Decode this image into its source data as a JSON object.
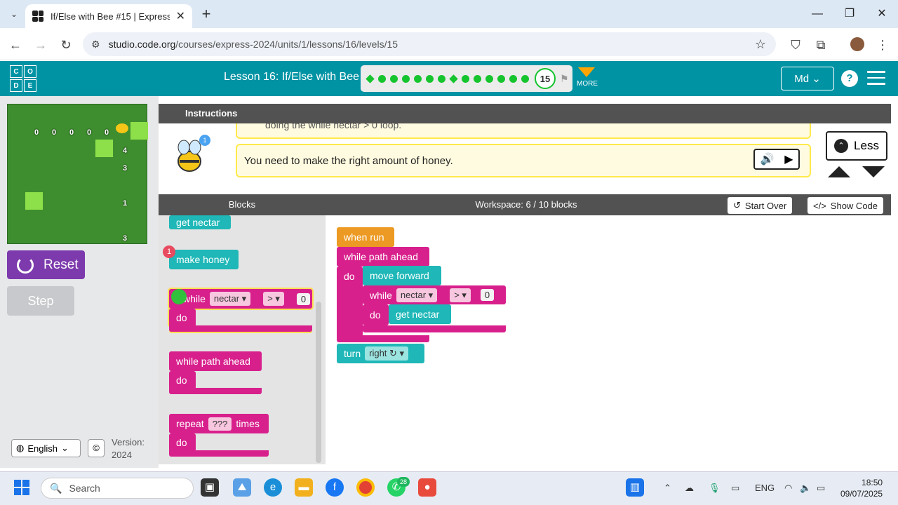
{
  "browser": {
    "tab_title": "If/Else with Bee #15 | Express C",
    "tab_close": "✕",
    "new_tab": "+",
    "url_host": "studio.code.org",
    "url_path": "/courses/express-2024/units/1/lessons/16/levels/15",
    "minimize": "—",
    "restore": "❐",
    "close": "✕"
  },
  "header": {
    "logo_letters": [
      "C",
      "O",
      "D",
      "E"
    ],
    "lesson_title": "Lesson 16: If/Else with Bee",
    "level_number": "15",
    "progress_completed": 14,
    "more_label": "MORE",
    "user_label": "Md",
    "help_label": "?"
  },
  "left_panel": {
    "reset_label": "Reset",
    "step_label": "Step",
    "language": "English",
    "copyright": "©",
    "version_label": "Version:",
    "version_value": "2024",
    "maze_labels": [
      "0",
      "0",
      "0",
      "0",
      "0",
      "4",
      "3",
      "1",
      "3"
    ]
  },
  "instructions": {
    "tab_label": "Instructions",
    "partial_text": "doing the while nectar > 0 loop.",
    "message": "You need to make the right amount of honey.",
    "hint_count": "1",
    "less_label": "Less"
  },
  "workspace": {
    "blocks_header": "Blocks",
    "workspace_header": "Workspace: 6 / 10 blocks",
    "start_over": "Start Over",
    "show_code": "Show Code"
  },
  "toolbox": {
    "get_nectar": "get nectar",
    "make_honey": "make honey",
    "make_honey_badge": "1",
    "while_label": "while",
    "nectar_dropdown": "nectar ▾",
    "op_dropdown": "> ▾",
    "zero": "0",
    "do_label": "do",
    "while_path": "while path ahead",
    "repeat_label": "repeat",
    "repeat_value": "???",
    "times_label": "times"
  },
  "program": {
    "when_run": "when run",
    "while_path": "while path ahead",
    "do1": "do",
    "move_forward": "move forward",
    "while_label": "while",
    "nectar_dropdown": "nectar ▾",
    "op_dropdown": "> ▾",
    "zero": "0",
    "do2": "do",
    "get_nectar": "get nectar",
    "turn_label": "turn",
    "turn_dir": "right ↻ ▾"
  },
  "taskbar": {
    "search_placeholder": "Search",
    "whatsapp_badge": "28",
    "lang": "ENG",
    "time": "18:50",
    "date": "09/07/2025"
  },
  "colors": {
    "header": "#0093a4",
    "teal_block": "#1fb7b7",
    "pink_block": "#d8208c",
    "event_block": "#ec9a23",
    "reset_button": "#7c3aac",
    "progress_green": "#16c42e"
  }
}
